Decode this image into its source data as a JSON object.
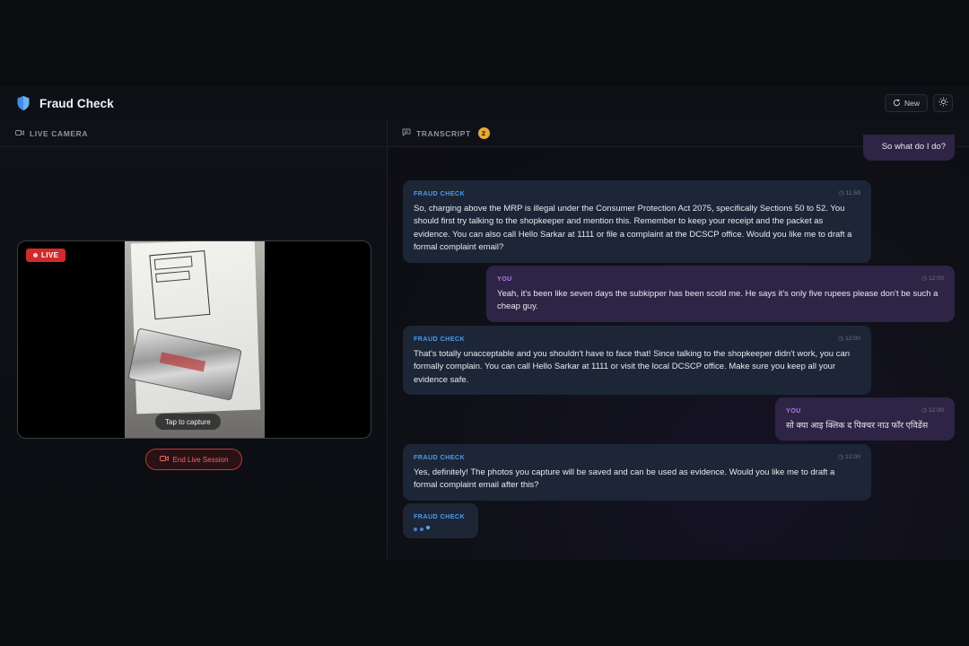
{
  "app": {
    "title": "Fraud Check",
    "new_label": "New",
    "accent": "#4d9be8"
  },
  "camera": {
    "header": "LIVE CAMERA",
    "live_label": "LIVE",
    "tap_label": "Tap to capture",
    "end_label": "End Live Session"
  },
  "transcript": {
    "header": "TRANSCRIPT",
    "count": "2",
    "partial_user_message": "So what do I do?",
    "messages": [
      {
        "sender": "FRAUD CHECK",
        "time": "11:59",
        "text": "So, charging above the MRP is illegal under the Consumer Protection Act 2075, specifically Sections 50 to 52. You should first try talking to the shopkeeper and mention this. Remember to keep your receipt and the packet as evidence. You can also call Hello Sarkar at 1111 or file a complaint at the DCSCP office. Would you like me to draft a formal complaint email?"
      },
      {
        "sender": "YOU",
        "time": "12:00",
        "text": "Yeah, it's been like seven days the subkipper has been scold me. He says it's only five rupees please don't be such a cheap guy."
      },
      {
        "sender": "FRAUD CHECK",
        "time": "12:00",
        "text": "That's totally unacceptable and you shouldn't have to face that! Since talking to the shopkeeper didn't work, you can formally complain. You can call Hello Sarkar at 1111 or visit the local DCSCP office. Make sure you keep all your evidence safe."
      },
      {
        "sender": "YOU",
        "time": "12:00",
        "text": "सो क्या आइ क्लिक द पिक्चर नाउ फॉर एविडेंस"
      },
      {
        "sender": "FRAUD CHECK",
        "time": "12:00",
        "text": "Yes, definitely! The photos you capture will be saved and can be used as evidence. Would you like me to draft a formal complaint email after this?"
      },
      {
        "sender": "FRAUD CHECK"
      }
    ]
  }
}
